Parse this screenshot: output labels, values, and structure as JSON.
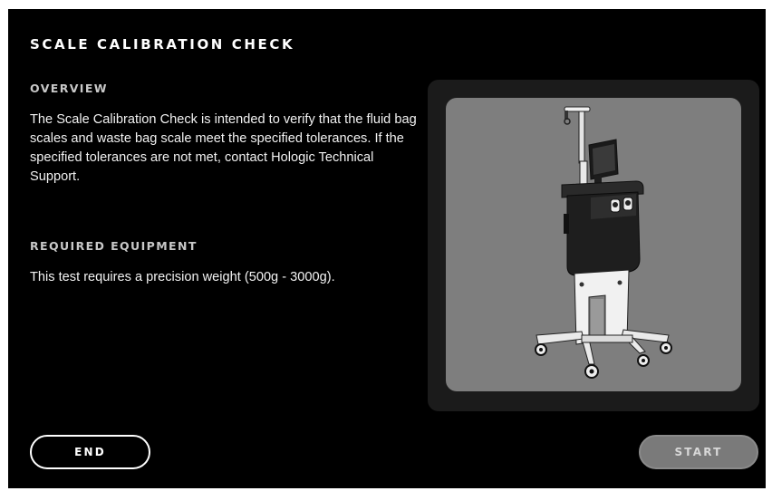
{
  "page": {
    "title": "SCALE CALIBRATION CHECK"
  },
  "overview": {
    "heading": "OVERVIEW",
    "text": "The Scale Calibration Check is intended to verify that the fluid bag scales and waste bag scale meet the specified tolerances. If the specified tolerances are not met, contact Hologic Technical Support."
  },
  "required_equipment": {
    "heading": "REQUIRED EQUIPMENT",
    "text": "This test requires a precision weight (500g - 3000g)."
  },
  "illustration": {
    "subject": "cart-mounted fluid management system with display, scale hooks and wheeled base",
    "background_color": "#7e7e7e"
  },
  "buttons": {
    "end_label": "END",
    "start_label": "START",
    "start_enabled": false
  },
  "colors": {
    "screen_background": "#000000",
    "panel_background": "#1b1b1b",
    "text_primary": "#ffffff",
    "heading_secondary": "#c8c8c8",
    "start_button_disabled": "#7a7a7a"
  }
}
